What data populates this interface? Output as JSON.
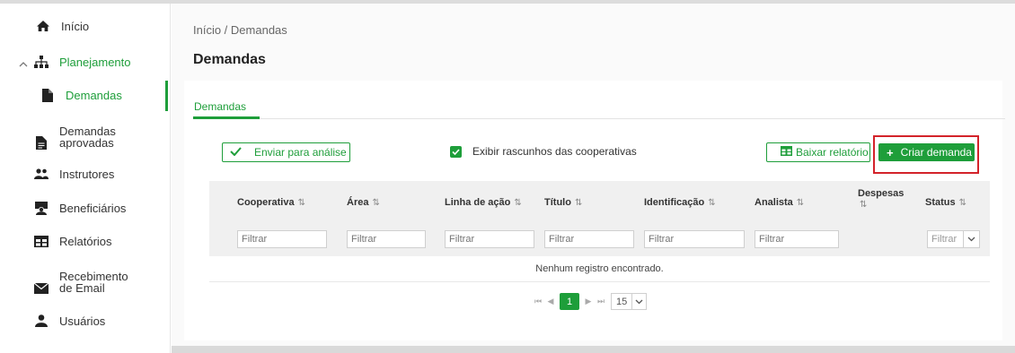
{
  "sidebar": {
    "items": [
      {
        "label": "Início",
        "icon": "home-icon"
      },
      {
        "label": "Planejamento",
        "icon": "sitemap-icon"
      },
      {
        "label": "Demandas",
        "icon": "file-icon"
      },
      {
        "label": "Demandas aprovadas",
        "icon": "file-text-icon"
      },
      {
        "label": "Instrutores",
        "icon": "users-icon"
      },
      {
        "label": "Beneficiários",
        "icon": "teacher-icon"
      },
      {
        "label": "Relatórios",
        "icon": "table-icon"
      },
      {
        "label": "Recebimento de Email",
        "icon": "envelope-icon"
      },
      {
        "label": "Usuários",
        "icon": "user-icon"
      }
    ]
  },
  "breadcrumb": "Início / Demandas",
  "page_title": "Demandas",
  "tab_label": "Demandas",
  "toolbar": {
    "send_label": "Enviar para análise",
    "drafts_label": "Exibir rascunhos das cooperativas",
    "drafts_checked": true,
    "report_label": "Baixar relatório",
    "create_label": "Criar demanda"
  },
  "table": {
    "columns": [
      "Cooperativa",
      "Área",
      "Linha de ação",
      "Título",
      "Identificação",
      "Analista",
      "Despesas",
      "Status"
    ],
    "filter_placeholder": "Filtrar",
    "empty_message": "Nenhum registro encontrado."
  },
  "pagination": {
    "current_page": "1",
    "page_size": "15"
  },
  "colors": {
    "accent": "#1e9e3a",
    "highlight": "#d3232a"
  }
}
